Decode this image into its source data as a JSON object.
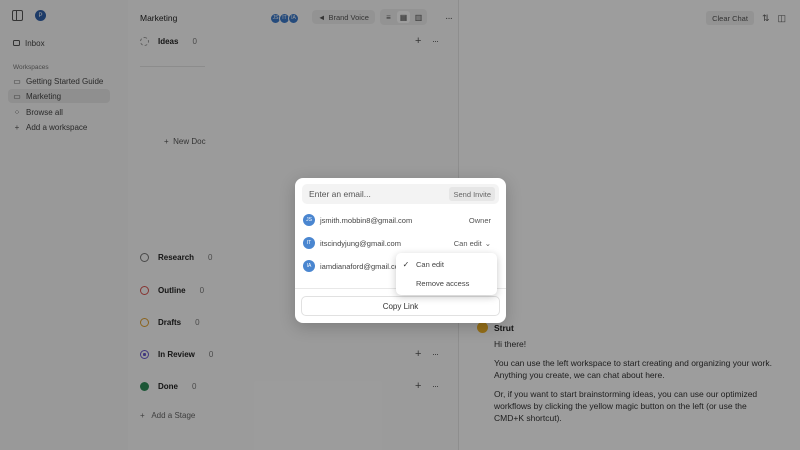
{
  "sidebar": {
    "logo_letter": "P",
    "inbox": "Inbox",
    "section_label": "Workspaces",
    "items": [
      {
        "label": "Getting Started Guide"
      },
      {
        "label": "Marketing"
      },
      {
        "label": "Browse all"
      },
      {
        "label": "Add a workspace"
      }
    ]
  },
  "board": {
    "title": "Marketing",
    "avatars": [
      "JS",
      "IT",
      "IA"
    ],
    "brand_voice": "Brand Voice",
    "new_doc": "New Doc",
    "add_stage": "Add a Stage",
    "stages": [
      {
        "name": "Ideas",
        "count": "0",
        "color": "#9a9a9a"
      },
      {
        "name": "Research",
        "count": "0",
        "color": "#777777"
      },
      {
        "name": "Outline",
        "count": "0",
        "color": "#d9534f"
      },
      {
        "name": "Drafts",
        "count": "0",
        "color": "#e0a030"
      },
      {
        "name": "In Review",
        "count": "0",
        "color": "#6a5acd"
      },
      {
        "name": "Done",
        "count": "0",
        "color": "#2e8b57"
      }
    ]
  },
  "chat": {
    "clear_label": "Clear Chat",
    "sender": "Strut",
    "messages": [
      "Hi there!",
      "You can use the left workspace to start creating and organizing your work. Anything you create, we can chat about here.",
      "Or, if you want to start brainstorming ideas, you can use our optimized workflows by clicking the yellow magic button on the left (or use the CMD+K shortcut)."
    ]
  },
  "share_modal": {
    "email_placeholder": "Enter an email...",
    "send_label": "Send Invite",
    "members": [
      {
        "initials": "JS",
        "email": "jsmith.mobbin8@gmail.com",
        "role": "Owner"
      },
      {
        "initials": "IT",
        "email": "itscindyjung@gmail.com",
        "role": "Can edit"
      },
      {
        "initials": "IA",
        "email": "iamdianaford@gmail.com",
        "role": ""
      }
    ],
    "copy_link_label": "Copy Link"
  },
  "role_dropdown": {
    "options": [
      {
        "label": "Can edit",
        "checked": "✓"
      },
      {
        "label": "Remove access",
        "checked": ""
      }
    ]
  },
  "colors": {
    "accent": "#3d79c9",
    "strut": "#f0b429"
  }
}
